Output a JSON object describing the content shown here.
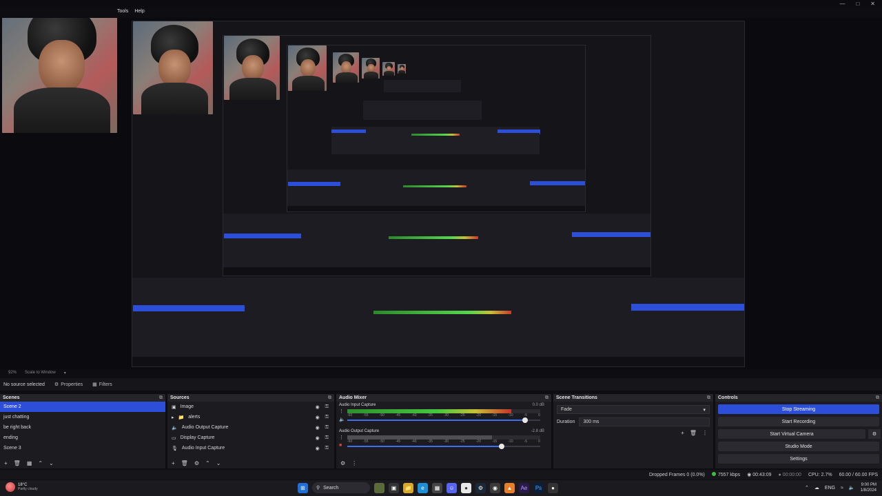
{
  "menu": {
    "items": [
      "Tools",
      "Help"
    ]
  },
  "preview": {
    "zoom": "92%",
    "scale_mode": "Scale to Window"
  },
  "context_bar": {
    "no_source": "No source selected",
    "properties": "Properties",
    "filters": "Filters"
  },
  "scenes": {
    "title": "Scenes",
    "items": [
      "Scene 2",
      "just chatting",
      "be right back",
      "ending",
      "Scene 3"
    ],
    "selected_index": 0
  },
  "sources": {
    "title": "Sources",
    "items": [
      {
        "label": "Image",
        "icon": "image-icon"
      },
      {
        "label": "alerts",
        "icon": "folder-icon"
      },
      {
        "label": "Audio Output Capture",
        "icon": "speaker-icon"
      },
      {
        "label": "Display Capture",
        "icon": "monitor-icon"
      },
      {
        "label": "Audio Input Capture",
        "icon": "microphone-icon"
      }
    ]
  },
  "mixer": {
    "title": "Audio Mixer",
    "channels": [
      {
        "name": "Audio Input Capture",
        "db": "0.0 dB",
        "level": 0.85,
        "volume": 0.92
      },
      {
        "name": "Audio Output Capture",
        "db": "-2.8 dB",
        "level": 0.0,
        "volume": 0.8
      }
    ],
    "ticks": [
      "-60",
      "-55",
      "-50",
      "-45",
      "-40",
      "-35",
      "-30",
      "-25",
      "-20",
      "-15",
      "-10",
      "-5",
      "0"
    ]
  },
  "transitions": {
    "title": "Scene Transitions",
    "selected": "Fade",
    "duration_label": "Duration",
    "duration_value": "300 ms"
  },
  "controls": {
    "title": "Controls",
    "stop_streaming": "Stop Streaming",
    "start_recording": "Start Recording",
    "start_virtual_camera": "Start Virtual Camera",
    "studio_mode": "Studio Mode",
    "settings": "Settings"
  },
  "status": {
    "dropped_frames": "Dropped Frames 0 (0.0%)",
    "bitrate": "7557 kbps",
    "stream_time": "00:43:09",
    "rec_time": "00:00:00",
    "cpu": "CPU: 2.7%",
    "fps": "60.00 / 60.00 FPS"
  },
  "taskbar": {
    "temperature": "18°C",
    "condition": "Partly cloudy",
    "search": "Search",
    "language": "ENG",
    "time": "9:00 PM",
    "date": "1/8/2024"
  },
  "colors": {
    "accent": "#2c4ed8",
    "panel": "#1b1b20",
    "background": "#0e0e12"
  }
}
